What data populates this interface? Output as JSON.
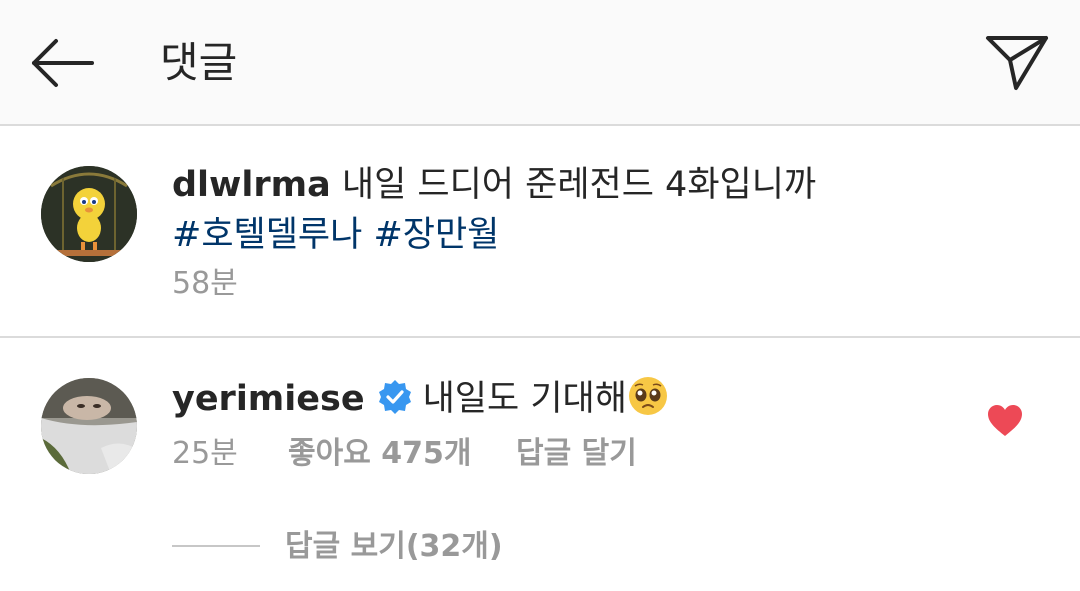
{
  "header": {
    "title": "댓글",
    "back_icon": "arrow-left-icon",
    "send_icon": "paper-plane-icon"
  },
  "post": {
    "username": "dlwlrma",
    "caption_text": "내일 드디어 준레전드 4화입니까",
    "hashtags": "#호텔델루나 #장만월",
    "time": "58분"
  },
  "comment": {
    "username": "yerimiese",
    "verified": true,
    "text": "내일도 기대해",
    "emoji": "pleading-face-emoji",
    "time": "25분",
    "likes": "좋아요 475개",
    "reply_label": "답글 달기",
    "liked": true,
    "view_replies": "답글 보기(32개)"
  },
  "colors": {
    "hashtag": "#003569",
    "heart": "#ed4956",
    "verified": "#3897f0",
    "secondary_text": "#999999"
  }
}
